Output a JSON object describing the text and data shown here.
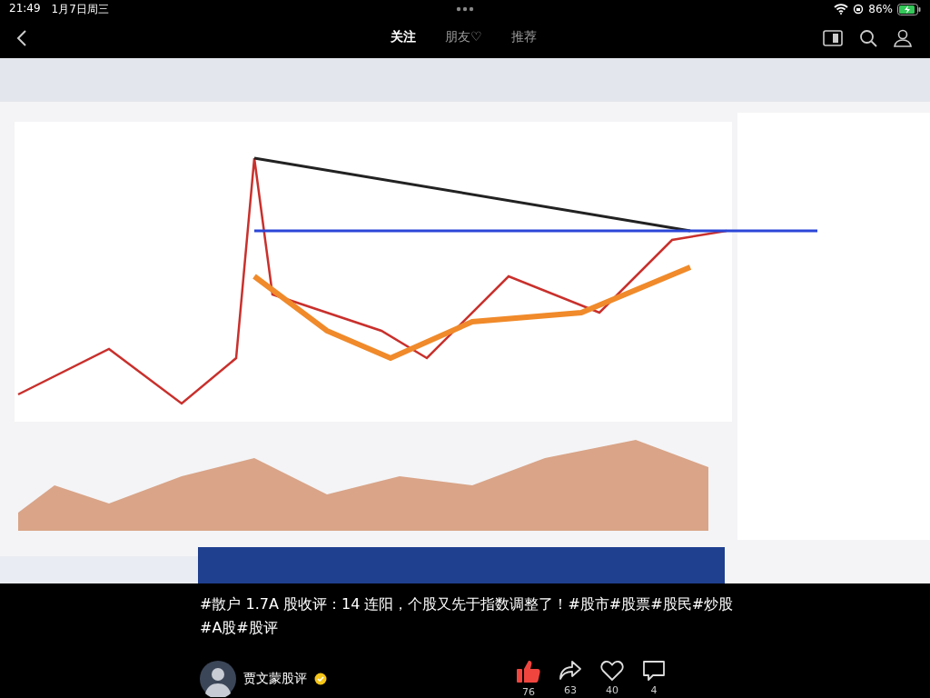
{
  "status_bar": {
    "time": "21:49",
    "date": "1月7日周三",
    "battery": "86%"
  },
  "tabs": [
    {
      "label": "关注",
      "selected": true
    },
    {
      "label": "朋友♡",
      "selected": false
    },
    {
      "label": "推荐",
      "selected": false
    }
  ],
  "caption": "#散户 1.7A 股收评：14 连阳，个股又先于指数调整了！#股市#股票#股民#炒股#A股#股评",
  "author": {
    "name": "贾文蒙股评",
    "verified": true
  },
  "actions": [
    {
      "kind": "like",
      "count": "76"
    },
    {
      "kind": "share",
      "count": "63"
    },
    {
      "kind": "favorite",
      "count": "40"
    },
    {
      "kind": "comment",
      "count": "4"
    }
  ]
}
